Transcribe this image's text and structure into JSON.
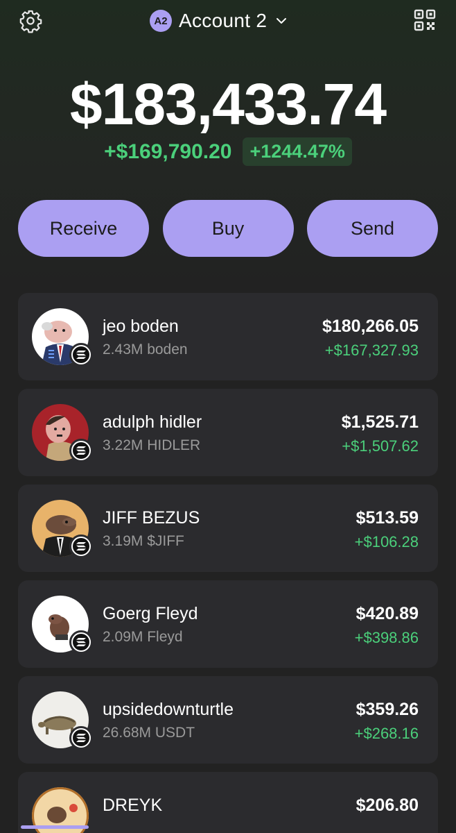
{
  "header": {
    "account_badge": "A2",
    "account_name": "Account 2",
    "icons": [
      "gear-icon",
      "chevron-down-icon",
      "qr-code-icon"
    ]
  },
  "portfolio": {
    "balance": "$183,433.74",
    "change_abs": "+$169,790.20",
    "change_pct": "+1244.47%"
  },
  "actions": {
    "receive": "Receive",
    "buy": "Buy",
    "send": "Send"
  },
  "colors": {
    "accent": "#ab9ff2",
    "gain": "#4bd07b",
    "card": "#2b2b2e"
  },
  "tokens": [
    {
      "name": "jeo boden",
      "amount": "2.43M boden",
      "value": "$180,266.05",
      "gain": "+$167,327.93"
    },
    {
      "name": "adulph hidler",
      "amount": "3.22M HIDLER",
      "value": "$1,525.71",
      "gain": "+$1,507.62"
    },
    {
      "name": "JIFF BEZUS",
      "amount": "3.19M $JIFF",
      "value": "$513.59",
      "gain": "+$106.28"
    },
    {
      "name": "Goerg Fleyd",
      "amount": "2.09M Fleyd",
      "value": "$420.89",
      "gain": "+$398.86"
    },
    {
      "name": "upsidedownturtle",
      "amount": "26.68M USDT",
      "value": "$359.26",
      "gain": "+$268.16"
    },
    {
      "name": "DREYK",
      "amount": "",
      "value": "$206.80",
      "gain": ""
    }
  ]
}
